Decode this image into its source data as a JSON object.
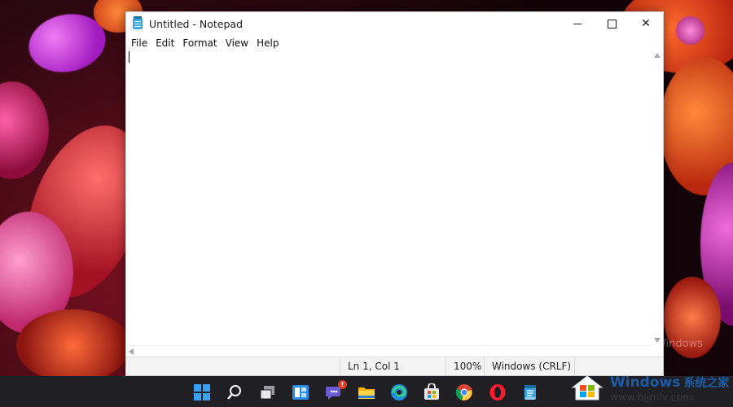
{
  "window": {
    "title": "Untitled - Notepad",
    "controls": {
      "minimize": "",
      "maximize": "",
      "close": "✕"
    }
  },
  "menu": [
    "File",
    "Edit",
    "Format",
    "View",
    "Help"
  ],
  "editor": {
    "content": ""
  },
  "status": {
    "position": "Ln 1, Col 1",
    "zoom": "100%",
    "line_ending": "Windows (CRLF)"
  },
  "taskbar": {
    "icons": [
      "windows-start-icon",
      "search-icon",
      "task-view-icon",
      "widgets-icon",
      "teams-chat-icon",
      "file-explorer-icon",
      "edge-icon",
      "store-icon",
      "chrome-icon",
      "opera-icon",
      "notepad-icon"
    ],
    "chat_badge": "!"
  },
  "desktop": {
    "faint_text": "Windows"
  },
  "watermark": {
    "title": "Windows",
    "cn": "系统之家",
    "url": "www.bjjmlv.com"
  },
  "colors": {
    "accent": "#1a5ca8",
    "taskbar": "#1f1f24"
  }
}
